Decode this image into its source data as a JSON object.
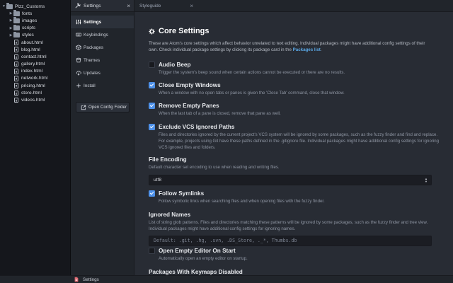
{
  "tree": {
    "root": "Plzz_Customs",
    "folders": [
      "fonts",
      "images",
      "scripts",
      "styles"
    ],
    "files": [
      "about.html",
      "blog.html",
      "contact.html",
      "gallery.html",
      "index.html",
      "network.html",
      "pricing.html",
      "store.html",
      "videos.html"
    ]
  },
  "panel": {
    "tab_label": "Settings",
    "nav": [
      {
        "label": "Settings",
        "icon": "sliders-icon",
        "active": true
      },
      {
        "label": "Keybindings",
        "icon": "keyboard-icon"
      },
      {
        "label": "Packages",
        "icon": "package-icon"
      },
      {
        "label": "Themes",
        "icon": "paintcan-icon"
      },
      {
        "label": "Updates",
        "icon": "cloud-download-icon"
      },
      {
        "label": "Install",
        "icon": "plus-icon"
      }
    ],
    "open_config": "Open Config Folder"
  },
  "tabs": [
    {
      "label": "Styleguide"
    }
  ],
  "core": {
    "heading": "Core Settings",
    "intro": "These are Atom's core settings which affect behavior unrelated to text editing. Individual packages might have additional config settings of their own. Check individual package settings by clicking its package card in the ",
    "intro_link": "Packages list",
    "intro_end": ".",
    "settings": {
      "audio_beep": {
        "title": "Audio Beep",
        "checked": false,
        "desc": "Trigger the system's beep sound when certain actions cannot be executed or there are no results."
      },
      "close_empty": {
        "title": "Close Empty Windows",
        "checked": true,
        "desc": "When a window with no open tabs or panes is given the 'Close Tab' command, close that window."
      },
      "remove_empty": {
        "title": "Remove Empty Panes",
        "checked": true,
        "desc": "When the last tab of a pane is closed, remove that pane as well."
      },
      "exclude_vcs": {
        "title": "Exclude VCS Ignored Paths",
        "checked": true,
        "desc": "Files and directories ignored by the current project's VCS system will be ignored by some packages, such as the fuzzy finder and find and replace. For example, projects using Git have these paths defined in the .gitignore file. Individual packages might have additional config settings for ignoring VCS ignored files and folders."
      },
      "file_encoding": {
        "title": "File Encoding",
        "desc": "Default character set encoding to use when reading and writing files.",
        "value": "utf8"
      },
      "follow_symlinks": {
        "title": "Follow Symlinks",
        "checked": true,
        "desc": "Follow symbolic links when searching files and when opening files with the fuzzy finder."
      },
      "ignored_names": {
        "title": "Ignored Names",
        "desc": "List of string glob patterns. Files and directories matching these patterns will be ignored by some packages, such as the fuzzy finder and tree view. Individual packages might have additional config settings for ignoring names.",
        "placeholder": "Default: .git, .hg, .svn, .DS_Store, ._*, Thumbs.db"
      },
      "open_empty_editor": {
        "title": "Open Empty Editor On Start",
        "checked": false,
        "desc": "Automatically open an empty editor on startup."
      },
      "packages_keymaps": {
        "title": "Packages With Keymaps Disabled"
      }
    }
  },
  "statusbar": {
    "label": "Settings"
  },
  "colors": {
    "accent": "#4d90e8",
    "link": "#5aa7e4",
    "background": "#282c34"
  }
}
